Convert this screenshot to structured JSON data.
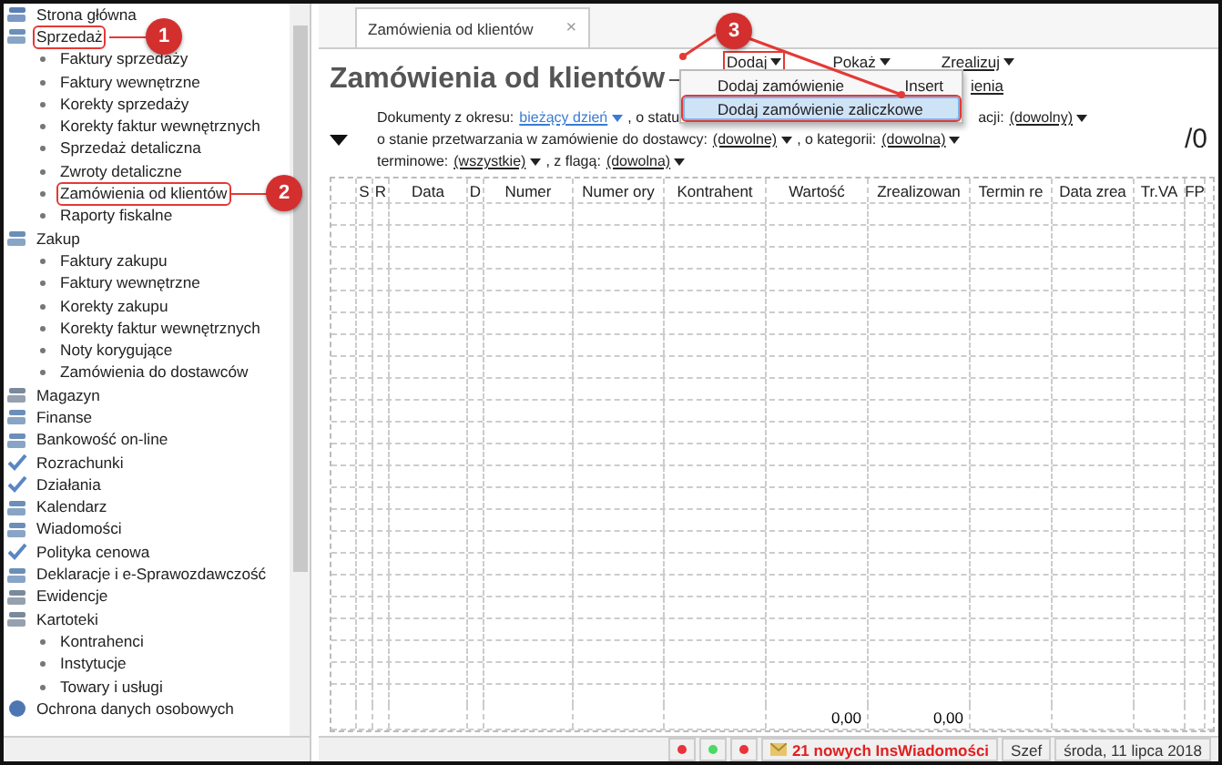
{
  "sidebar": {
    "items": [
      {
        "label": "Strona główna"
      },
      {
        "label": "Sprzedaż",
        "callout": "1",
        "children": [
          {
            "label": "Faktury sprzedaży"
          },
          {
            "label": "Faktury wewnętrzne"
          },
          {
            "label": "Korekty sprzedaży"
          },
          {
            "label": "Korekty faktur wewnętrznych"
          },
          {
            "label": "Sprzedaż detaliczna"
          },
          {
            "label": "Zwroty detaliczne"
          },
          {
            "label": "Zamówienia od klientów",
            "callout": "2"
          },
          {
            "label": "Raporty fiskalne"
          }
        ]
      },
      {
        "label": "Zakup",
        "children": [
          {
            "label": "Faktury zakupu"
          },
          {
            "label": "Faktury wewnętrzne"
          },
          {
            "label": "Korekty zakupu"
          },
          {
            "label": "Korekty faktur wewnętrznych"
          },
          {
            "label": "Noty korygujące"
          },
          {
            "label": "Zamówienia do dostawców"
          }
        ]
      },
      {
        "label": "Magazyn"
      },
      {
        "label": "Finanse"
      },
      {
        "label": "Bankowość on-line"
      },
      {
        "label": "Rozrachunki"
      },
      {
        "label": "Działania"
      },
      {
        "label": "Kalendarz"
      },
      {
        "label": "Wiadomości"
      },
      {
        "label": "Polityka cenowa"
      },
      {
        "label": "Deklaracje i e-Sprawozdawczość"
      },
      {
        "label": "Ewidencje"
      },
      {
        "label": "Kartoteki",
        "children": [
          {
            "label": "Kontrahenci"
          },
          {
            "label": "Instytucje"
          },
          {
            "label": "Towary i usługi"
          }
        ]
      },
      {
        "label": "Ochrona danych osobowych"
      }
    ]
  },
  "tab": {
    "label": "Zamówienia od klientów",
    "close": "×"
  },
  "title": "Zamówienia od klientów",
  "toolbar": [
    {
      "label": "Dodaj",
      "callout": "3"
    },
    {
      "label": "Pokaż"
    },
    {
      "label": "Zrealizuj"
    }
  ],
  "menu": {
    "items": [
      {
        "label": "Dodaj zamówienie",
        "shortcut": "Insert",
        "selected": false
      },
      {
        "label": "Dodaj zamówienie zaliczkowe",
        "selected": true
      }
    ],
    "behind_text": "ienia"
  },
  "filters": [
    [
      {
        "kind": "text",
        "text": "Dokumenty z okresu:"
      },
      {
        "kind": "link",
        "text": "bieżący dzień"
      },
      {
        "kind": "text",
        "text": ", o statu"
      },
      {
        "kind": "gap"
      },
      {
        "kind": "text",
        "text": "acji:"
      },
      {
        "kind": "drop",
        "text": "(dowolny)"
      }
    ],
    [
      {
        "kind": "text",
        "text": "o stanie przetwarzania w zamówienie do dostawcy:"
      },
      {
        "kind": "drop",
        "text": "(dowolne)"
      },
      {
        "kind": "text",
        "text": ", o kategorii:"
      },
      {
        "kind": "drop",
        "text": "(dowolna)"
      }
    ],
    [
      {
        "kind": "text",
        "text": "terminowe:"
      },
      {
        "kind": "drop",
        "text": "(wszystkie)"
      },
      {
        "kind": "text",
        "text": ", z flagą:"
      },
      {
        "kind": "drop",
        "text": "(dowolna)"
      }
    ]
  ],
  "count": "/0",
  "table": {
    "columns": [
      "S",
      "R",
      "Data",
      "D",
      "Numer",
      "Numer ory",
      "Kontrahent",
      "Wartość",
      "Zrealizowan",
      "Termin re",
      "Data zrea",
      "Tr.VA",
      "FP"
    ],
    "totals": [
      "0,00",
      "0,00"
    ]
  },
  "status_bar": {
    "dots": [
      {
        "color": "#e8343a"
      },
      {
        "color": "#4cd964"
      },
      {
        "color": "#e8343a"
      }
    ],
    "messages": "21 nowych InsWiadomości",
    "user": "Szef",
    "date": "środa, 11 lipca 2018"
  }
}
